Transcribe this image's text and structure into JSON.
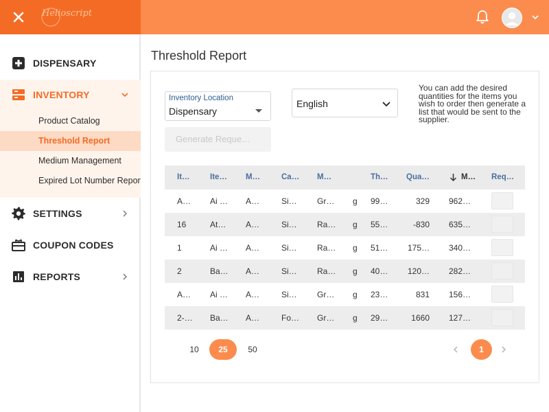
{
  "header": {
    "logo_text": "Helioscript",
    "accent_color": "#fb8c4d",
    "dark_accent_color": "#f46b25"
  },
  "sidebar": {
    "items": [
      {
        "label": "DISPENSARY",
        "icon": "plus-square-icon"
      },
      {
        "label": "INVENTORY",
        "icon": "inventory-icon"
      },
      {
        "label": "SETTINGS",
        "icon": "gear-icon"
      },
      {
        "label": "COUPON CODES",
        "icon": "coupon-icon"
      },
      {
        "label": "REPORTS",
        "icon": "bar-chart-icon"
      }
    ],
    "inventory_sub": [
      {
        "label": "Product Catalog"
      },
      {
        "label": "Threshold Report"
      },
      {
        "label": "Medium Management"
      },
      {
        "label": "Expired Lot Number Reports"
      }
    ]
  },
  "page": {
    "title": "Threshold Report"
  },
  "filters": {
    "location_label": "Inventory Location",
    "location_value": "Dispensary",
    "language_value": "English",
    "help_text": "You can add the desired quantities for the items you wish to order then generate a list that would be sent to the supplier.",
    "generate_label": "Generate Reque…"
  },
  "table": {
    "headers": [
      "It…",
      "Ite…",
      "M…",
      "Ca…",
      "M…",
      "",
      "Th…",
      "Qua…",
      "M…",
      "Req…"
    ],
    "sort_icon": "arrow-down-icon",
    "rows": [
      [
        "A…",
        "Ai …",
        "A…",
        "Si…",
        "Gr…",
        "g",
        "99…",
        "329",
        "962…"
      ],
      [
        "16",
        "At…",
        "A…",
        "Si…",
        "Ra…",
        "g",
        "55…",
        "-830",
        "635…"
      ],
      [
        "1",
        "Ai …",
        "A…",
        "Si…",
        "Ra…",
        "g",
        "51…",
        "175…",
        "340…"
      ],
      [
        "2",
        "Ba…",
        "A…",
        "Si…",
        "Ra…",
        "g",
        "40…",
        "120…",
        "282…"
      ],
      [
        "A…",
        "Ai …",
        "A…",
        "Si…",
        "Gr…",
        "g",
        "23…",
        "831",
        "156…"
      ],
      [
        "2-…",
        "Ba…",
        "A…",
        "Fo…",
        "Gr…",
        "g",
        "29…",
        "1660",
        "127…"
      ]
    ]
  },
  "pagination": {
    "sizes": [
      "10",
      "25",
      "50"
    ],
    "active_size": "25",
    "current_page": "1"
  }
}
